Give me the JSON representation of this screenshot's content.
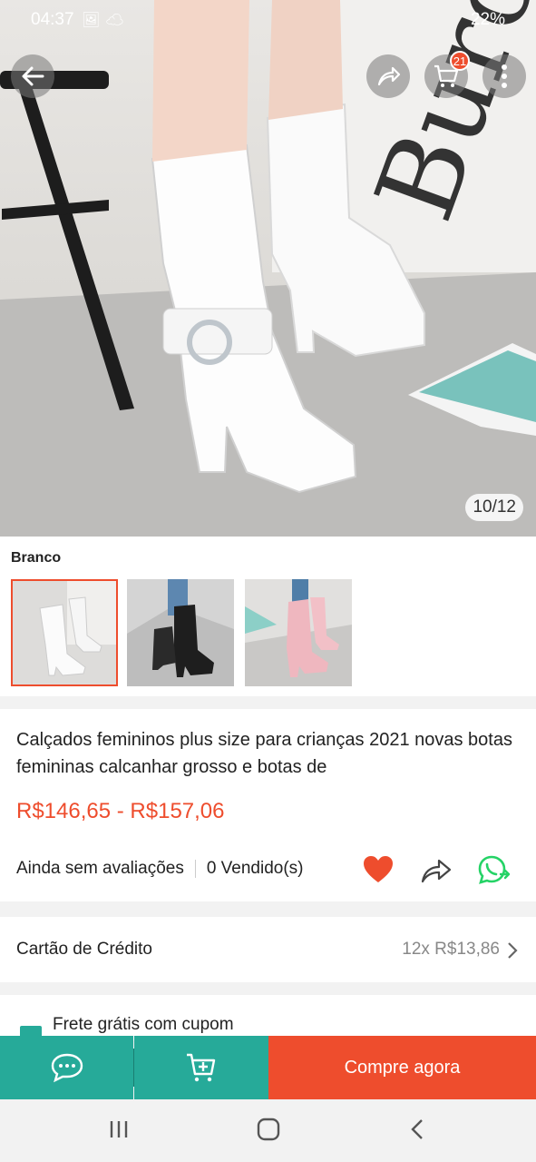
{
  "status_bar": {
    "time": "04:37",
    "battery": "22%"
  },
  "header": {
    "cart_count": "21"
  },
  "gallery": {
    "counter": "10/12"
  },
  "variants": {
    "label": "Branco"
  },
  "product": {
    "title": "Calçados femininos plus size para crianças 2021 novas botas femininas calcanhar grosso e botas de",
    "price": "R$146,65 - R$157,06",
    "reviews": "Ainda sem avaliações",
    "sold": "0 Vendido(s)"
  },
  "payment": {
    "label": "Cartão de Crédito",
    "installments": "12x R$13,86"
  },
  "shipping": {
    "label": "Frete grátis com cupom"
  },
  "bottom_bar": {
    "buy_label": "Compre agora"
  },
  "colors": {
    "accent": "#ee4d2d",
    "teal": "#26aa99",
    "whatsapp": "#25d366"
  }
}
